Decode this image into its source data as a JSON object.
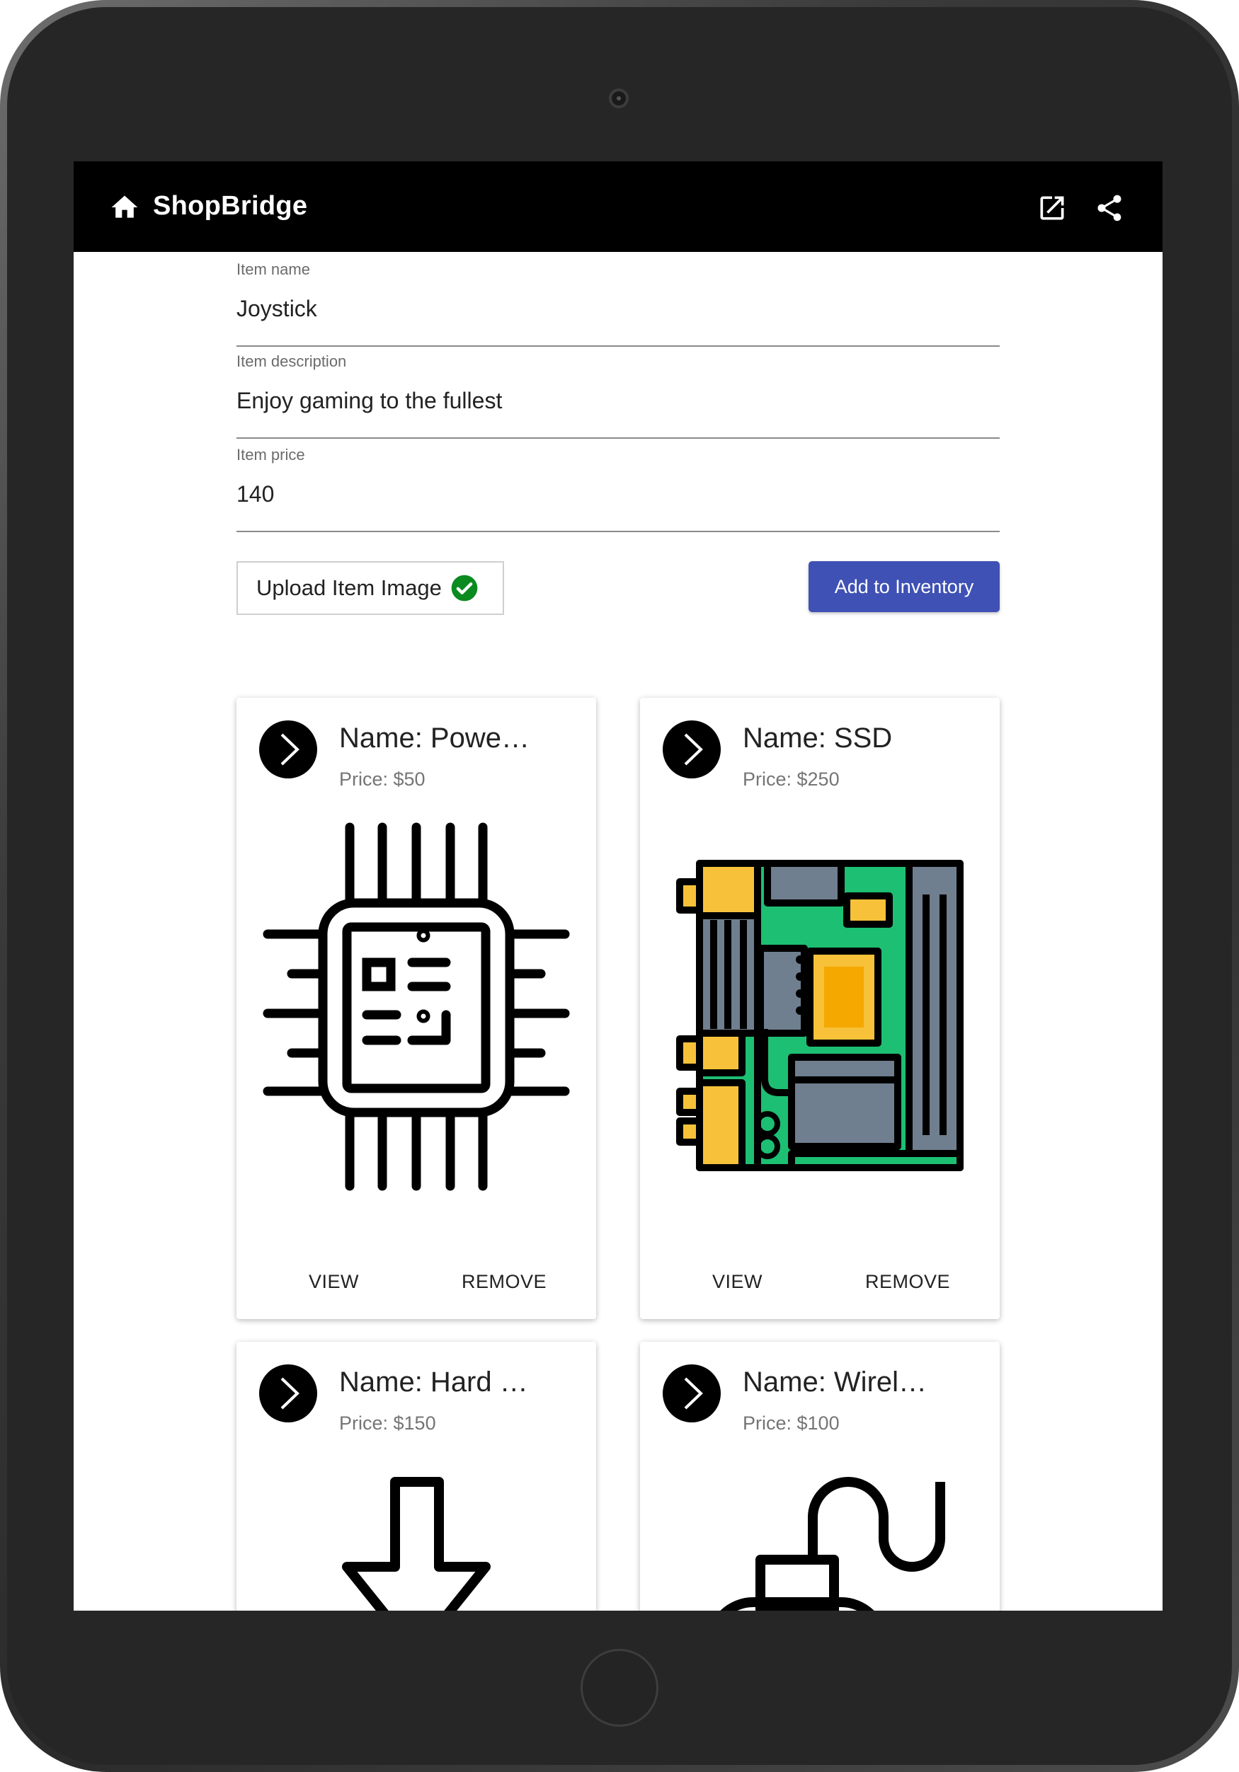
{
  "app": {
    "title": "ShopBridge",
    "icons": [
      "home-icon",
      "open-in-new-icon",
      "share-icon"
    ]
  },
  "form": {
    "item_name": {
      "label": "Item name",
      "value": "Joystick"
    },
    "item_description": {
      "label": "Item description",
      "value": "Enjoy gaming to the fullest"
    },
    "item_price": {
      "label": "Item price",
      "value": "140"
    },
    "upload_label": "Upload Item Image",
    "upload_status_icon": "check-circle-icon",
    "add_button": "Add to Inventory"
  },
  "cards": [
    {
      "name": "Name: Powe…",
      "price": "Price: $50",
      "image": "cpu-chip-icon",
      "view": "VIEW",
      "remove": "REMOVE"
    },
    {
      "name": "Name: SSD",
      "price": "Price: $250",
      "image": "motherboard-icon",
      "view": "VIEW",
      "remove": "REMOVE"
    },
    {
      "name": "Name: Hard …",
      "price": "Price: $150",
      "image": "download-arrow-icon"
    },
    {
      "name": "Name: Wirel…",
      "price": "Price: $100",
      "image": "mouse-cable-icon"
    }
  ],
  "colors": {
    "appbar": "#000000",
    "primary_button": "#3f51b5",
    "success": "#0a8a1f",
    "board_green": "#1dbf73",
    "board_yellow": "#f7c23a",
    "board_gray": "#6f7f8f"
  }
}
